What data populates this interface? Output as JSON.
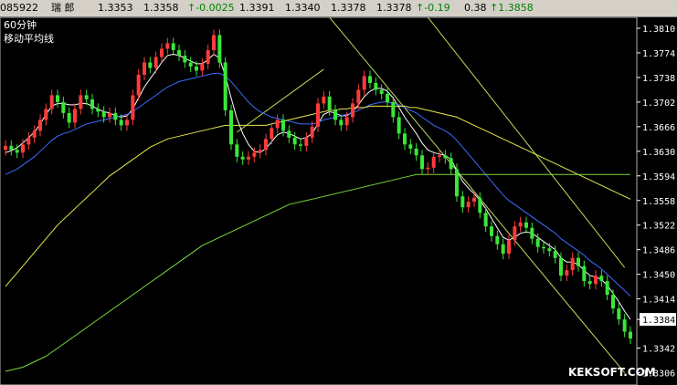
{
  "quote": {
    "code": "085922",
    "name": "瑞 郎",
    "price": "1.3353",
    "open": "1.3358",
    "change": "↑-0.0025",
    "high": "1.3391",
    "low": "1.3340",
    "bid": "1.3378",
    "ask": "1.3378",
    "change_pct": "↑-0.19",
    "amount": "0.38",
    "last": "↑1.3858"
  },
  "chart_data": {
    "type": "candlestick",
    "period_label": "60分钟",
    "indicator_label": "移动平均线",
    "ylim": [
      1.3288,
      1.3826
    ],
    "y_ticks": [
      "1.3810",
      "1.3774",
      "1.3738",
      "1.3702",
      "1.3666",
      "1.3630",
      "1.3594",
      "1.3558",
      "1.3522",
      "1.3486",
      "1.3450",
      "1.3414",
      "1.3384",
      "1.3342",
      "1.3306"
    ],
    "current_price": "1.3384",
    "close_series": [
      1.3638,
      1.3632,
      1.3628,
      1.364,
      1.365,
      1.366,
      1.3676,
      1.3692,
      1.3712,
      1.3702,
      1.3686,
      1.3672,
      1.3692,
      1.3712,
      1.3706,
      1.3692,
      1.3688,
      1.368,
      1.3686,
      1.3676,
      1.3668,
      1.3676,
      1.3712,
      1.3742,
      1.376,
      1.3752,
      1.3768,
      1.378,
      1.3788,
      1.3778,
      1.377,
      1.376,
      1.3754,
      1.3748,
      1.3758,
      1.3778,
      1.38,
      1.376,
      1.369,
      1.364,
      1.3622,
      1.3618,
      1.3622,
      1.3628,
      1.3632,
      1.3648,
      1.3664,
      1.3676,
      1.366,
      1.365,
      1.364,
      1.3638,
      1.365,
      1.3666,
      1.37,
      1.371,
      1.369,
      1.3676,
      1.3668,
      1.368,
      1.37,
      1.372,
      1.374,
      1.373,
      1.372,
      1.3714,
      1.3702,
      1.368,
      1.3656,
      1.364,
      1.3634,
      1.3624,
      1.3604,
      1.3606,
      1.3622,
      1.3624,
      1.362,
      1.3604,
      1.3564,
      1.3548,
      1.3556,
      1.3562,
      1.354,
      1.352,
      1.3506,
      1.3494,
      1.348,
      1.35,
      1.352,
      1.3526,
      1.3518,
      1.3502,
      1.349,
      1.3488,
      1.3484,
      1.3474,
      1.3448,
      1.3456,
      1.3474,
      1.3462,
      1.344,
      1.3436,
      1.3448,
      1.344,
      1.342,
      1.34,
      1.3384,
      1.3366,
      1.3356
    ],
    "moving_averages": [
      {
        "color": "#ffffff",
        "values": [
          1.3628,
          1.3631,
          1.3635,
          1.3642,
          1.365,
          1.3658,
          1.367,
          1.3684,
          1.3696,
          1.37,
          1.37,
          1.3698,
          1.3698,
          1.37,
          1.37,
          1.3696,
          1.3692,
          1.3688,
          1.3686,
          1.3682,
          1.368,
          1.3682,
          1.3692,
          1.3708,
          1.3724,
          1.3736,
          1.3748,
          1.376,
          1.377,
          1.3772,
          1.377,
          1.3766,
          1.3762,
          1.3758,
          1.3758,
          1.3764,
          1.3772,
          1.3766,
          1.374,
          1.3708,
          1.3678,
          1.3656,
          1.364,
          1.363,
          1.3628,
          1.3634,
          1.3644,
          1.3654,
          1.3658,
          1.3656,
          1.3652,
          1.3648,
          1.365,
          1.3656,
          1.367,
          1.3684,
          1.3688,
          1.3686,
          1.3682,
          1.3682,
          1.3688,
          1.3698,
          1.371,
          1.3718,
          1.3722,
          1.3722,
          1.3718,
          1.3708,
          1.3694,
          1.368,
          1.3668,
          1.3656,
          1.3642,
          1.3632,
          1.3628,
          1.3626,
          1.3624,
          1.3618,
          1.3602,
          1.3586,
          1.3576,
          1.3568,
          1.3558,
          1.3546,
          1.3532,
          1.3518,
          1.3504,
          1.35,
          1.3504,
          1.351,
          1.3512,
          1.351,
          1.3504,
          1.3498,
          1.3492,
          1.3486,
          1.3474,
          1.3468,
          1.3468,
          1.3464,
          1.3456,
          1.3448,
          1.3446,
          1.3442,
          1.3434,
          1.3422,
          1.341,
          1.3396,
          1.3384
        ]
      },
      {
        "color": "#3a6cff",
        "values": [
          1.3596,
          1.36,
          1.3604,
          1.361,
          1.3616,
          1.3622,
          1.363,
          1.3638,
          1.3646,
          1.3652,
          1.3656,
          1.3658,
          1.3662,
          1.3666,
          1.367,
          1.3672,
          1.3674,
          1.3676,
          1.3678,
          1.368,
          1.3682,
          1.3684,
          1.3688,
          1.3694,
          1.37,
          1.3706,
          1.3712,
          1.3718,
          1.3724,
          1.3728,
          1.3732,
          1.3734,
          1.3736,
          1.3738,
          1.374,
          1.3742,
          1.3744,
          1.3744,
          1.374,
          1.3732,
          1.3722,
          1.3712,
          1.3702,
          1.3694,
          1.3688,
          1.3684,
          1.368,
          1.3678,
          1.3676,
          1.3674,
          1.3672,
          1.367,
          1.367,
          1.367,
          1.3672,
          1.3676,
          1.3678,
          1.368,
          1.3682,
          1.3684,
          1.3686,
          1.369,
          1.3694,
          1.3698,
          1.37,
          1.3702,
          1.3702,
          1.37,
          1.3698,
          1.3694,
          1.369,
          1.3686,
          1.368,
          1.3674,
          1.3668,
          1.3664,
          1.366,
          1.3654,
          1.3646,
          1.3636,
          1.3626,
          1.3616,
          1.3606,
          1.3596,
          1.3586,
          1.3576,
          1.3566,
          1.3558,
          1.3552,
          1.3546,
          1.354,
          1.3534,
          1.3528,
          1.3522,
          1.3516,
          1.351,
          1.3502,
          1.3496,
          1.349,
          1.3484,
          1.3478,
          1.347,
          1.3464,
          1.3458,
          1.345,
          1.3442,
          1.3434,
          1.3426,
          1.3418
        ]
      },
      {
        "color": "#e8e84a",
        "values": [
          1.3432,
          1.3442,
          1.3452,
          1.3462,
          1.3472,
          1.3482,
          1.3492,
          1.3502,
          1.3512,
          1.3522,
          1.353,
          1.3538,
          1.3546,
          1.3554,
          1.3562,
          1.357,
          1.3578,
          1.3586,
          1.3594,
          1.36,
          1.3606,
          1.3612,
          1.3618,
          1.3624,
          1.363,
          1.3636,
          1.364,
          1.3644,
          1.3648,
          1.365,
          1.3652,
          1.3654,
          1.3656,
          1.3658,
          1.366,
          1.3662,
          1.3664,
          1.3666,
          1.3668,
          1.3668,
          1.3668,
          1.3668,
          1.3668,
          1.3668,
          1.3668,
          1.3668,
          1.367,
          1.3672,
          1.3674,
          1.3676,
          1.3678,
          1.368,
          1.3682,
          1.3684,
          1.3686,
          1.3688,
          1.369,
          1.369,
          1.3692,
          1.3692,
          1.3694,
          1.3694,
          1.3694,
          1.3696,
          1.3696,
          1.3696,
          1.3696,
          1.3696,
          1.3696,
          1.3696,
          1.3694,
          1.3694,
          1.3692,
          1.369,
          1.3688,
          1.3686,
          1.3684,
          1.3682,
          1.368,
          1.3676,
          1.3672,
          1.3668,
          1.3664,
          1.366,
          1.3656,
          1.3652,
          1.3648,
          1.3644,
          1.364,
          1.3636,
          1.3632,
          1.3628,
          1.3624,
          1.362,
          1.3616,
          1.3612,
          1.3608,
          1.3604,
          1.36,
          1.3596,
          1.3592,
          1.3588,
          1.3584,
          1.358,
          1.3576,
          1.3572,
          1.3568,
          1.3564,
          1.356
        ]
      },
      {
        "color": "#7cd93a",
        "values": [
          1.3308,
          1.331,
          1.3312,
          1.3314,
          1.3318,
          1.3322,
          1.3326,
          1.333,
          1.3336,
          1.3342,
          1.3348,
          1.3354,
          1.336,
          1.3366,
          1.3372,
          1.3378,
          1.3384,
          1.339,
          1.3396,
          1.3402,
          1.3408,
          1.3414,
          1.342,
          1.3426,
          1.3432,
          1.3438,
          1.3444,
          1.345,
          1.3456,
          1.3462,
          1.3468,
          1.3474,
          1.348,
          1.3486,
          1.3492,
          1.3496,
          1.35,
          1.3504,
          1.3508,
          1.3512,
          1.3516,
          1.352,
          1.3524,
          1.3528,
          1.3532,
          1.3536,
          1.354,
          1.3544,
          1.3548,
          1.3552,
          1.3554,
          1.3556,
          1.3558,
          1.356,
          1.3562,
          1.3564,
          1.3566,
          1.3568,
          1.357,
          1.3572,
          1.3574,
          1.3576,
          1.3578,
          1.358,
          1.3582,
          1.3584,
          1.3586,
          1.3588,
          1.359,
          1.3592,
          1.3594,
          1.3596,
          1.3596,
          1.3596,
          1.3596,
          1.3596,
          1.3596,
          1.3596,
          1.3596,
          1.3596,
          1.3596,
          1.3596,
          1.3596,
          1.3596,
          1.3596,
          1.3596,
          1.3596,
          1.3596,
          1.3596,
          1.3596,
          1.3596,
          1.3596,
          1.3596,
          1.3596,
          1.3596,
          1.3596,
          1.3596,
          1.3596,
          1.3596,
          1.3596,
          1.3596,
          1.3596,
          1.3596,
          1.3596,
          1.3596,
          1.3596,
          1.3596,
          1.3596,
          1.3596
        ]
      }
    ],
    "channel_lines": [
      {
        "color": "#b8e05a",
        "from": [
          56,
          1.3826
        ],
        "to": [
          107,
          1.3306
        ]
      },
      {
        "color": "#b8e05a",
        "from": [
          73,
          1.3826
        ],
        "to": [
          107,
          1.346
        ]
      },
      {
        "color": "#b8e05a",
        "from": [
          40,
          1.3658
        ],
        "to": [
          55,
          1.375
        ]
      }
    ]
  },
  "watermark": "KEKSOFT.COM"
}
